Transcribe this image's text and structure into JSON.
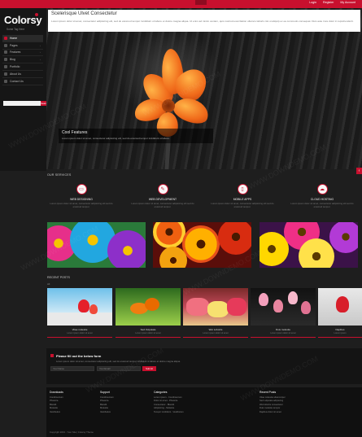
{
  "toplinks": [
    "Login",
    "Register",
    "My Account"
  ],
  "logo": {
    "text": "Colorsy",
    "tagline": "Some Tag Here"
  },
  "nav": [
    {
      "label": "Home",
      "active": true
    },
    {
      "label": "Pages",
      "chevron": "›"
    },
    {
      "label": "Features",
      "chevron": "›"
    },
    {
      "label": "Blog",
      "chevron": "›"
    },
    {
      "label": "Portfolio"
    },
    {
      "label": "About Us"
    },
    {
      "label": "Contact Us"
    }
  ],
  "search": {
    "placeholder": "",
    "button": "Search"
  },
  "hero": {
    "box_title": "Scelerisque Ulvet Consectetur",
    "box_text": "Lorem ipsum dolor sit amet, consectetur adipisicing elit, sed do eiusmod tempor incididunt ut labore et dolore magna aliqua. Ut enim ad minim veniam, quis nostrud exercitation ullamco laboris nisi ut aliquip ex ea commodo consequat. Duis aute irure dolor in reprehenderit.",
    "caption_title": "Cool Features",
    "caption_text": "Lorem ipsum dolor sit amet, consectetur adipisicing elit, sed do eiusmod tempor incididunt ut labore."
  },
  "services_title": "OUR SERVICES",
  "services": [
    {
      "icon": "monitor-icon",
      "glyph": "▭",
      "title": "WEB DESIGNING",
      "text": "Lorem ipsum dolor sit amet, consectetur adipisicing elit sed do eiusmod tempor."
    },
    {
      "icon": "code-icon",
      "glyph": "✎",
      "title": "WEB DEVELOPMENT",
      "text": "Lorem ipsum dolor sit amet, consectetur adipisicing elit sed do eiusmod tempor."
    },
    {
      "icon": "mobile-icon",
      "glyph": "▯",
      "title": "MOBILE APPS",
      "text": "Lorem ipsum dolor sit amet, consectetur adipisicing elit sed do eiusmod tempor."
    },
    {
      "icon": "cloud-icon",
      "glyph": "☁",
      "title": "CLOUD HOSTING",
      "text": "Lorem ipsum dolor sit amet, consectetur adipisicing elit sed do eiusmod tempor."
    }
  ],
  "posts_title": "RECENT POSTS",
  "post_tabs": "All",
  "posts": [
    {
      "title": "Vitae molestie",
      "sub": "Lorem ipsum dolor sit amet"
    },
    {
      "title": "Sed Vulputate",
      "sub": "Lorem ipsum dolor sit amet"
    },
    {
      "title": "Wet Lobortis",
      "sub": "Lorem ipsum dolor sit amet"
    },
    {
      "title": "Duis molestie",
      "sub": "Lorem ipsum dolor sit amet"
    },
    {
      "title": "Dapibus",
      "sub": "Lorem ipsum"
    }
  ],
  "form": {
    "title": "Please fill out the below form",
    "text": "Lorem ipsum dolor sit amet, consectetur adipisicing elit, sed do eiusmod tempor incididunt ut labore et dolore magna aliqua.",
    "name_placeholder": "Your Name",
    "email_placeholder": "Your Email",
    "button": "Submit"
  },
  "footer": {
    "columns": [
      {
        "title": "Downloads",
        "items": [
          "Condimentum",
          "Pharetra",
          "Blandit",
          "Molestie",
          "Vestibulum"
        ]
      },
      {
        "title": "Support",
        "items": [
          "Condimentum",
          "Pharetra",
          "Blandit",
          "Molestie",
          "Vestibulum"
        ]
      },
      {
        "title": "Categories",
        "items": [
          "Lorem ipsum - Condimentum",
          "Dolor sit amet - Pharetra",
          "Consectetur - Blandit",
          "Adipisicing - Molestie",
          "Tempor incididunt - Vestibulum"
        ]
      },
      {
        "title": "Recent Posts",
        "items": [
          "Vitae molestie ullamcorper",
          "Sed vulputate adipiscing",
          "Wet lobortis consectetur",
          "Duis molestie tempor",
          "Dapibus dolor sit amet"
        ]
      }
    ],
    "copyright": "Copyright 2013 - Your Site | Colorsy Theme"
  },
  "watermark": "WWW.DOWNDEMO.COM",
  "colors": {
    "accent": "#c8102e",
    "bg": "#1e1e1e"
  }
}
